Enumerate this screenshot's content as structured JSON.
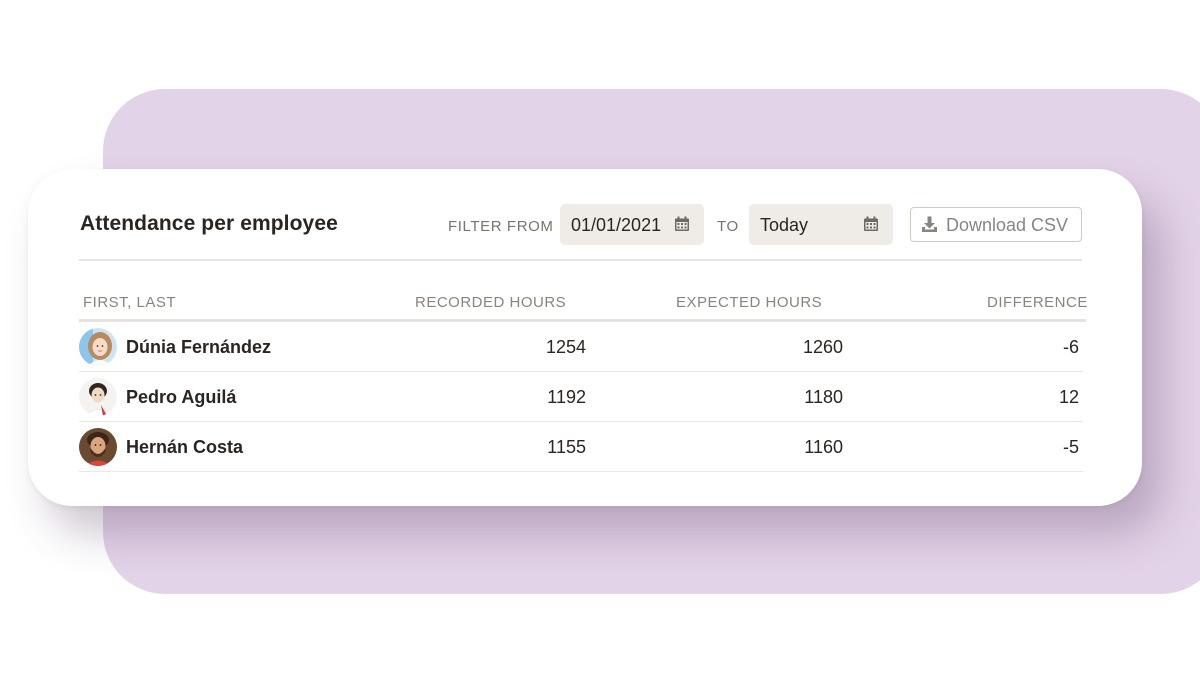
{
  "card": {
    "title": "Attendance per employee",
    "filter_from_label": "FILTER FROM",
    "from_date": "01/01/2021",
    "to_label": "TO",
    "to_date": "Today",
    "download_label": "Download CSV"
  },
  "table": {
    "headers": {
      "name": "FIRST, LAST",
      "recorded": "RECORDED HOURS",
      "expected": "EXPECTED HOURS",
      "difference": "DIFFERENCE"
    },
    "rows": [
      {
        "name": "Dúnia Fernández",
        "recorded": "1254",
        "expected": "1260",
        "difference": "-6"
      },
      {
        "name": "Pedro Aguilá",
        "recorded": "1192",
        "expected": "1180",
        "difference": "12"
      },
      {
        "name": "Hernán Costa",
        "recorded": "1155",
        "expected": "1160",
        "difference": "-5"
      }
    ]
  },
  "icons": {
    "calendar": "calendar-icon",
    "download": "download-icon"
  },
  "colors": {
    "backdrop": "#e3d3e8",
    "card": "#ffffff",
    "field_bg": "#efece7",
    "text_dark": "#2b2521",
    "text_muted": "#8a847e"
  }
}
